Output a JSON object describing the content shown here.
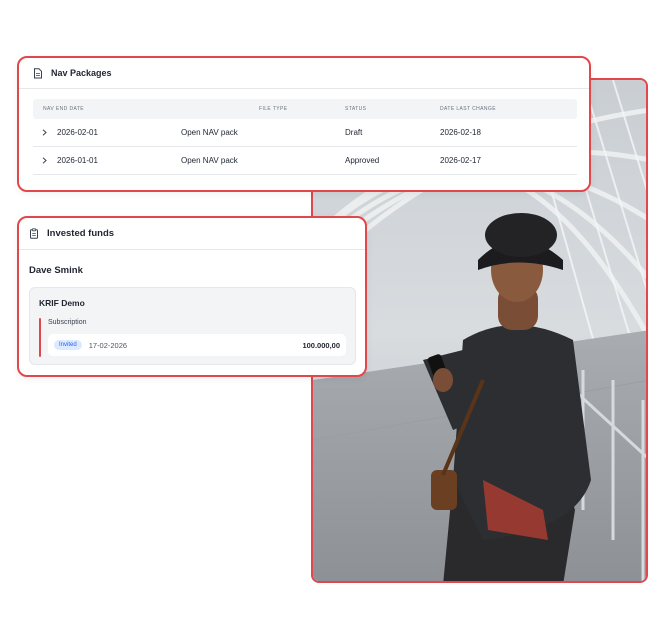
{
  "nav_packages": {
    "title": "Nav Packages",
    "columns": [
      "NAV END DATE",
      "FILE TYPE",
      "STATUS",
      "DATE LAST CHANGE"
    ],
    "rows": [
      {
        "nav_end_date": "2026-02-01",
        "name": "Open NAV pack",
        "file_type": "",
        "status": "Draft",
        "date_last_change": "2026-02-18"
      },
      {
        "nav_end_date": "2026-01-01",
        "name": "Open NAV pack",
        "file_type": "",
        "status": "Approved",
        "date_last_change": "2026-02-17"
      }
    ]
  },
  "invested_funds": {
    "title": "Invested funds",
    "investor_name": "Dave Smink",
    "fund": {
      "name": "KRIF Demo",
      "section_label": "Subscription",
      "transaction": {
        "status_badge": "Invited",
        "date": "17-02-2026",
        "amount": "100.000,00"
      }
    }
  },
  "icons": {
    "nav_packages": "document-icon",
    "invested_funds": "clipboard-icon",
    "row_expand": "chevron-right-icon"
  },
  "colors": {
    "card_border": "#e2474b",
    "badge_bg": "#dbeafe",
    "badge_text": "#2563eb"
  }
}
